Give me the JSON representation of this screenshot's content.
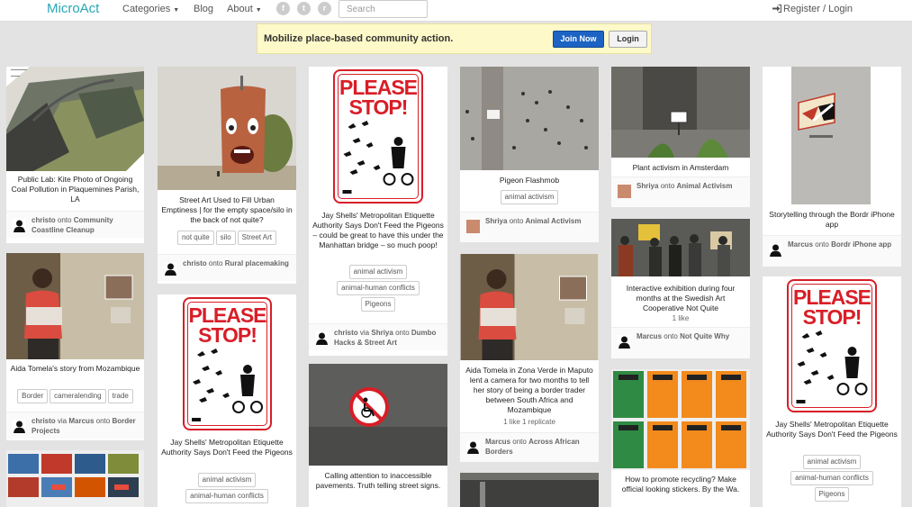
{
  "header": {
    "logo": "MicroAct",
    "nav": {
      "categories": "Categories",
      "blog": "Blog",
      "about": "About"
    },
    "social": {
      "facebook": "f",
      "twitter": "t",
      "rss": "r"
    },
    "search_placeholder": "Search",
    "register_login": "Register / Login"
  },
  "promo": {
    "text": "Mobilize place-based community action.",
    "join": "Join Now",
    "login": "Login"
  },
  "sign": {
    "title": "PLEASE STOP!"
  },
  "pins": [
    {
      "caption": "Public Lab: Kite Photo of Ongoing Coal Pollution in Plaquemines Parish, LA",
      "user": "christo",
      "via": "",
      "onto": "onto",
      "board": "Community Coastline Cleanup"
    },
    {
      "caption": "Street Art Used to Fill Urban Emptiness | for the empty space/silo in the back of not quite?",
      "tags": [
        "not quite",
        "silo",
        "Street Art"
      ],
      "user": "christo",
      "onto": "onto",
      "board": "Rural placemaking"
    },
    {
      "caption": "Jay Shells' Metropolitan Etiquette Authority Says Don't Feed the Pigeons – could be great to have this under the Manhattan bridge – so much poop!",
      "tags": [
        "animal activism",
        "animal-human conflicts",
        "Pigeons"
      ],
      "user": "christo",
      "via": "via",
      "via_user": "Shriya",
      "onto": "onto",
      "board": "Dumbo Hacks & Street Art"
    },
    {
      "caption": "Pigeon Flashmob",
      "tags": [
        "animal activism"
      ],
      "user": "Shriya",
      "onto": "onto",
      "board": "Animal Activism"
    },
    {
      "caption": "Plant activism in Amsterdam",
      "user": "Shriya",
      "onto": "onto",
      "board": "Animal Activism"
    },
    {
      "caption": "Storytelling through the Bordr iPhone app",
      "user": "Marcus",
      "onto": "onto",
      "board": "Bordr iPhone app"
    },
    {
      "caption": "Aida Tomela's story from Mozambique",
      "tags": [
        "Border",
        "cameralending",
        "trade"
      ],
      "user": "christo",
      "via": "via",
      "via_user": "Marcus",
      "onto": "onto",
      "board": "Border Projects"
    },
    {
      "caption": "Jay Shells' Metropolitan Etiquette Authority Says Don't Feed the Pigeons",
      "tags": [
        "animal activism",
        "animal-human conflicts"
      ]
    },
    {
      "caption": "Calling attention to inaccessible pavements. Truth telling street signs."
    },
    {
      "caption": "Aida Tomela in Zona Verde in Maputo lent a camera for two months to tell her story of being a border trader between South Africa and Mozambique",
      "stats": "1 like   1 replicate",
      "user": "Marcus",
      "onto": "onto",
      "board": "Across African Borders"
    },
    {
      "caption": "Interactive exhibition during four months at the Swedish Art Cooperative Not Quite",
      "stats": "1 like",
      "user": "Marcus",
      "onto": "onto",
      "board": "Not Quite Why"
    },
    {
      "caption": "How to promote recycling? Make official looking stickers. By the Wa."
    },
    {
      "caption": "Jay Shells' Metropolitan Etiquette Authority Says Don't Feed the Pigeons",
      "tags": [
        "animal activism",
        "animal-human conflicts",
        "Pigeons"
      ]
    }
  ]
}
